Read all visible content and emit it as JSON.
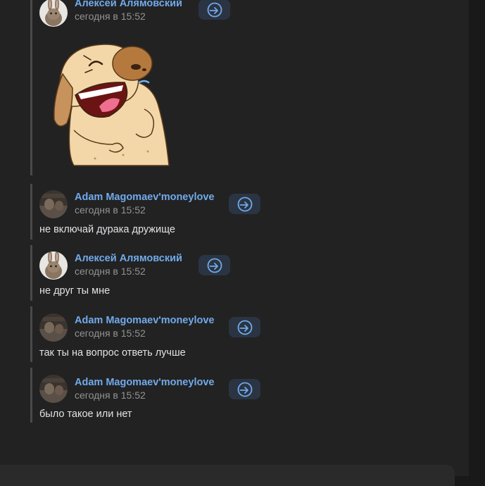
{
  "messages": [
    {
      "author": "Алексей Алямовский",
      "time": "сегодня в 15:52",
      "text": "",
      "avatar": "rabbit-avatar",
      "has_sticker": true,
      "sticker": "laughing-dog-sticker"
    },
    {
      "author": "Adam Magomaev'moneylove",
      "time": "сегодня в 15:52",
      "text": "не включай дурака дружище",
      "avatar": "photo-avatar"
    },
    {
      "author": "Алексей Алямовский",
      "time": "сегодня в 15:52",
      "text": "не друг ты мне",
      "avatar": "rabbit-avatar"
    },
    {
      "author": "Adam Magomaev'moneylove",
      "time": "сегодня в 15:52",
      "text": "так ты на вопрос ответь лучше",
      "avatar": "photo-avatar"
    },
    {
      "author": "Adam Magomaev'moneylove",
      "time": "сегодня в 15:52",
      "text": "было такое или нет",
      "avatar": "photo-avatar"
    }
  ],
  "icons": {
    "forward": "forward-icon"
  },
  "colors": {
    "background": "#222222",
    "author_name": "#71aaeb",
    "message_text": "#e1e3e6",
    "time_text": "#939393",
    "forward_button_bg": "#2b3442",
    "forward_icon": "#71aaeb"
  }
}
